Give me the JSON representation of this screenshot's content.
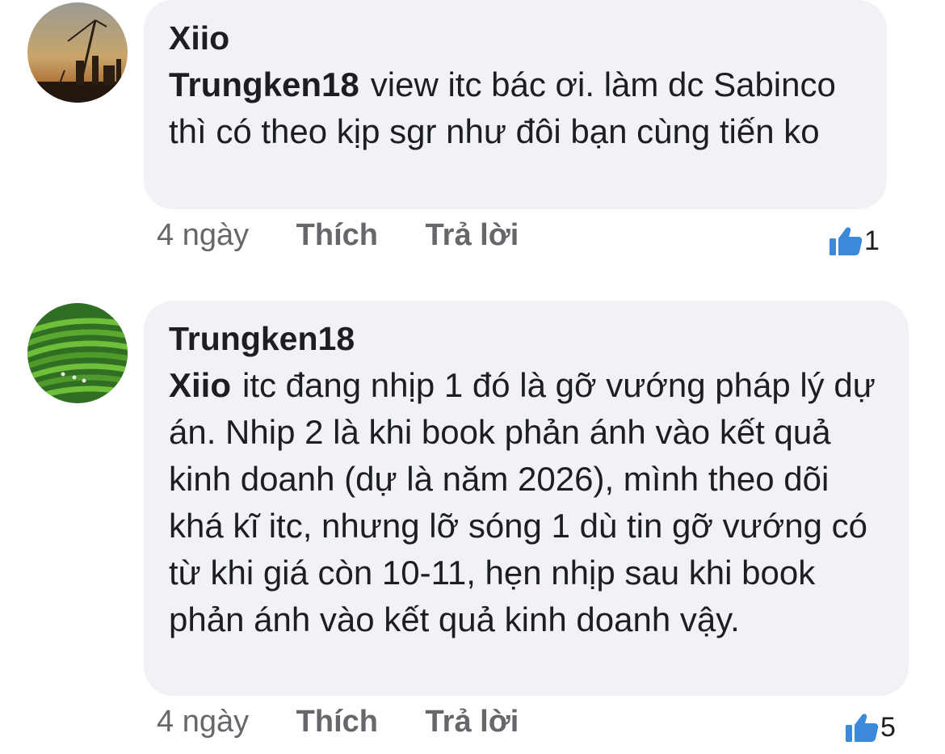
{
  "comments": [
    {
      "author": "Xiio",
      "mention": "Trungken18",
      "text": "view itc bác ơi. làm dc Sabinco thì có theo kịp sgr như đôi bạn cùng tiến ko",
      "time": "4 ngày",
      "like_label": "Thích",
      "reply_label": "Trả lời",
      "reaction_icon": "thumbs-up-icon",
      "reaction_count": "1",
      "avatar_scene": "sunset-construction-crane"
    },
    {
      "author": "Trungken18",
      "mention": "Xiio",
      "text": "itc đang nhịp 1 đó là gỡ vướng pháp lý dự án. Nhip 2 là khi book phản ánh vào kết quả kinh doanh (dự là năm 2026), mình theo dõi khá kĩ itc, nhưng lỡ sóng 1 dù tin gỡ vướng có từ khi giá còn 10-11, hẹn nhịp sau khi book phản ánh vào kết quả kinh doanh vậy.",
      "time": "4 ngày",
      "like_label": "Thích",
      "reply_label": "Trả lời",
      "reaction_icon": "thumbs-up-icon",
      "reaction_count": "5",
      "avatar_scene": "green-tea-hills"
    }
  ],
  "colors": {
    "bubble": "#f0f2f5",
    "text": "#1c1e21",
    "meta": "#65676b",
    "like_blue": "#3b8ad9"
  }
}
